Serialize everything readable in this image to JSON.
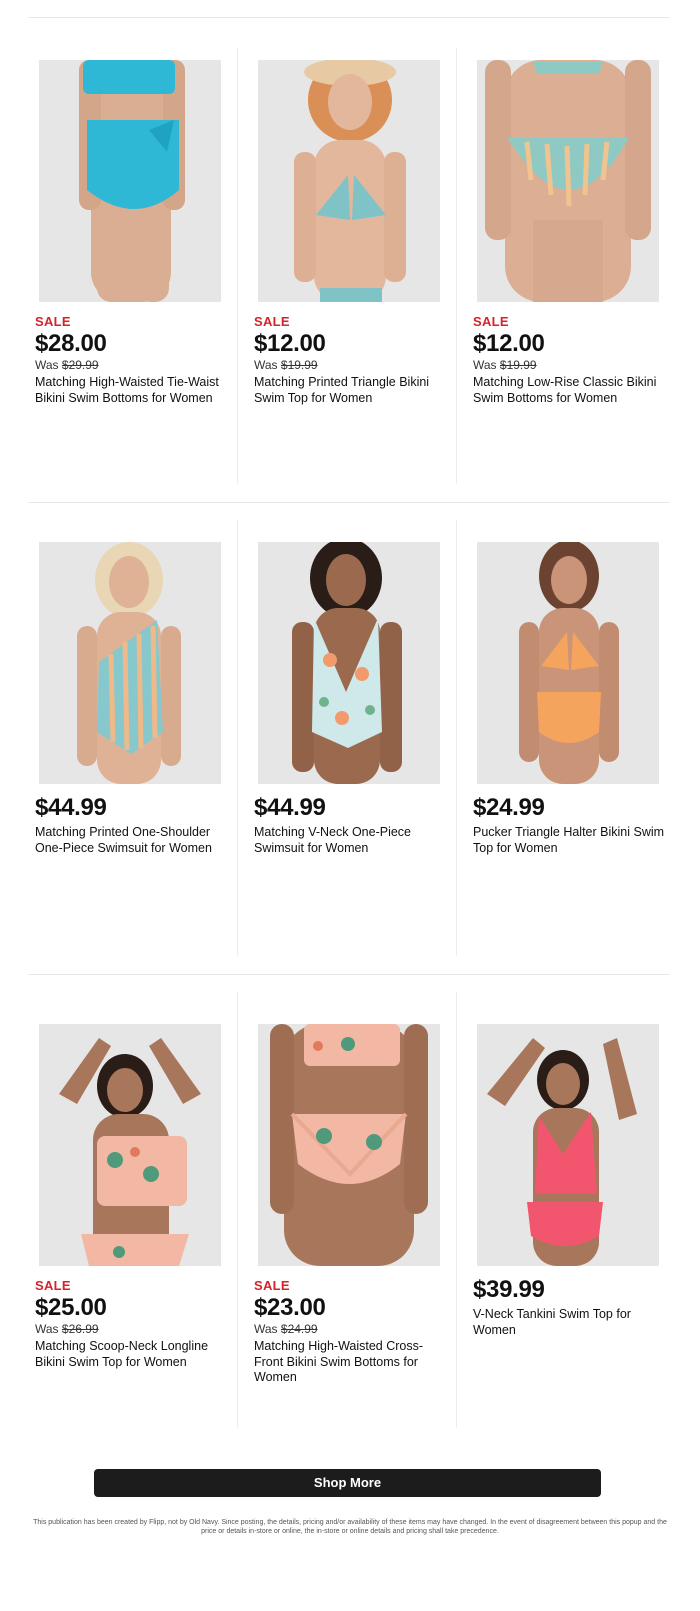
{
  "products": [
    {
      "sale": "SALE",
      "price": "$28.00",
      "was_label": "Was",
      "was_price": "$29.99",
      "name": "Matching High-Waisted Tie-Waist Bikini Swim Bottoms for Women",
      "image": "model-turquoise-high-waist-bottoms",
      "colors": {
        "primary": "#2fb8d6",
        "skin": "#d9ae92"
      }
    },
    {
      "sale": "SALE",
      "price": "$12.00",
      "was_label": "Was",
      "was_price": "$19.99",
      "name": "Matching Printed Triangle Bikini Swim Top for Women",
      "image": "model-striped-triangle-top",
      "colors": {
        "primary": "#7fc3c7",
        "skin": "#e3b79b"
      }
    },
    {
      "sale": "SALE",
      "price": "$12.00",
      "was_label": "Was",
      "was_price": "$19.99",
      "name": "Matching Low-Rise Classic Bikini Swim Bottoms for Women",
      "image": "model-striped-low-rise-bottoms",
      "colors": {
        "primary": "#8fc9c4",
        "skin": "#dcae94"
      }
    },
    {
      "sale": "",
      "price": "$44.99",
      "was_label": "",
      "was_price": "",
      "name": "Matching Printed One-Shoulder One-Piece Swimsuit for Women",
      "image": "model-striped-one-shoulder-swimsuit",
      "colors": {
        "primary": "#86c8cc",
        "skin": "#dfb296"
      }
    },
    {
      "sale": "",
      "price": "$44.99",
      "was_label": "",
      "was_price": "",
      "name": "Matching V-Neck One-Piece Swimsuit for Women",
      "image": "model-floral-v-neck-swimsuit",
      "colors": {
        "primary": "#cfe9ea",
        "skin": "#9b6a4e"
      }
    },
    {
      "sale": "",
      "price": "$24.99",
      "was_label": "",
      "was_price": "",
      "name": "Pucker Triangle Halter Bikini Swim Top for Women",
      "image": "model-orange-halter-bikini",
      "colors": {
        "primary": "#f5a45e",
        "skin": "#c99478"
      }
    },
    {
      "sale": "SALE",
      "price": "$25.00",
      "was_label": "Was",
      "was_price": "$26.99",
      "name": "Matching Scoop-Neck Longline Bikini Swim Top for Women",
      "image": "model-tropical-longline-top",
      "colors": {
        "primary": "#f2b8a4",
        "skin": "#a8765a"
      }
    },
    {
      "sale": "SALE",
      "price": "$23.00",
      "was_label": "Was",
      "was_price": "$24.99",
      "name": "Matching High-Waisted Cross-Front Bikini Swim Bottoms for Women",
      "image": "model-tropical-cross-front-bottoms",
      "colors": {
        "primary": "#f2b8a4",
        "skin": "#a8765a"
      }
    },
    {
      "sale": "",
      "price": "$39.99",
      "was_label": "",
      "was_price": "",
      "name": "V-Neck Tankini Swim Top for Women",
      "image": "model-pink-tankini",
      "colors": {
        "primary": "#f2566e",
        "skin": "#a8765a"
      }
    }
  ],
  "shop_more_label": "Shop More",
  "disclaimer": "This publication has been created by Flipp, not by Old Navy. Since posting, the details, pricing and/or availability of these items may have changed. In the event of disagreement between this popup and the price or details in-store or online, the in-store or online details and pricing shall take precedence."
}
